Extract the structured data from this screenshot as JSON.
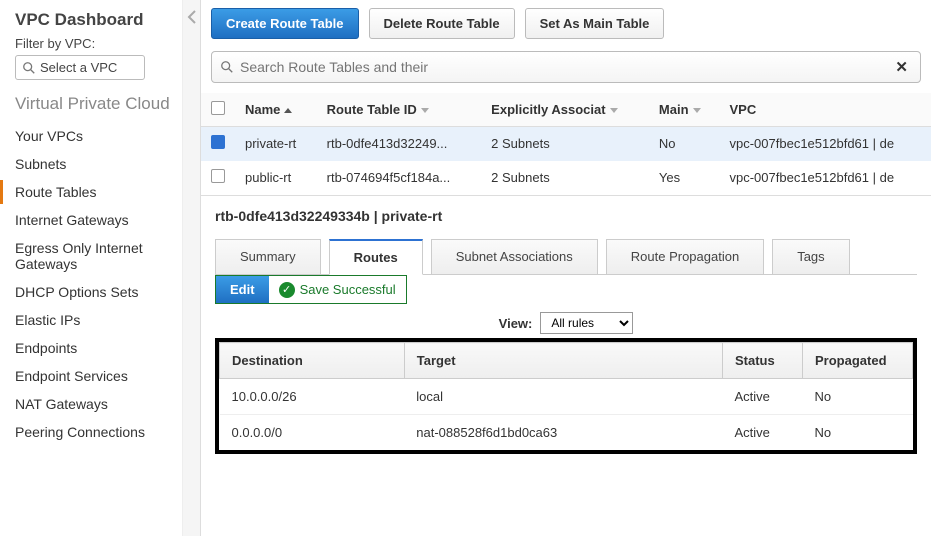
{
  "sidebar": {
    "title": "VPC Dashboard",
    "filter_label": "Filter by VPC:",
    "vpc_select_placeholder": "Select a VPC",
    "section_title": "Virtual Private Cloud",
    "items": [
      {
        "label": "Your VPCs"
      },
      {
        "label": "Subnets"
      },
      {
        "label": "Route Tables"
      },
      {
        "label": "Internet Gateways"
      },
      {
        "label": "Egress Only Internet Gateways"
      },
      {
        "label": "DHCP Options Sets"
      },
      {
        "label": "Elastic IPs"
      },
      {
        "label": "Endpoints"
      },
      {
        "label": "Endpoint Services"
      },
      {
        "label": "NAT Gateways"
      },
      {
        "label": "Peering Connections"
      }
    ]
  },
  "toolbar": {
    "create": "Create Route Table",
    "delete": "Delete Route Table",
    "set_main": "Set As Main Table"
  },
  "search": {
    "placeholder": "Search Route Tables and their"
  },
  "columns": {
    "name": "Name",
    "rtid": "Route Table ID",
    "assoc": "Explicitly Associat",
    "main": "Main",
    "vpc": "VPC"
  },
  "rows": [
    {
      "name": "private-rt",
      "rtid": "rtb-0dfe413d32249...",
      "assoc": "2 Subnets",
      "main": "No",
      "vpc": "vpc-007fbec1e512bfd61 | de"
    },
    {
      "name": "public-rt",
      "rtid": "rtb-074694f5cf184a...",
      "assoc": "2 Subnets",
      "main": "Yes",
      "vpc": "vpc-007fbec1e512bfd61 | de"
    }
  ],
  "detail": {
    "header": "rtb-0dfe413d32249334b | private-rt",
    "tabs": {
      "summary": "Summary",
      "routes": "Routes",
      "subnet": "Subnet Associations",
      "prop": "Route Propagation",
      "tags": "Tags"
    },
    "edit": "Edit",
    "save_msg": "Save Successful",
    "view_label": "View:",
    "view_value": "All rules",
    "route_cols": {
      "dest": "Destination",
      "target": "Target",
      "status": "Status",
      "prop": "Propagated"
    },
    "routes": [
      {
        "dest": "10.0.0.0/26",
        "target": "local",
        "target_link": false,
        "status": "Active",
        "prop": "No"
      },
      {
        "dest": "0.0.0.0/0",
        "target": "nat-088528f6d1bd0ca63",
        "target_link": true,
        "status": "Active",
        "prop": "No"
      }
    ]
  }
}
